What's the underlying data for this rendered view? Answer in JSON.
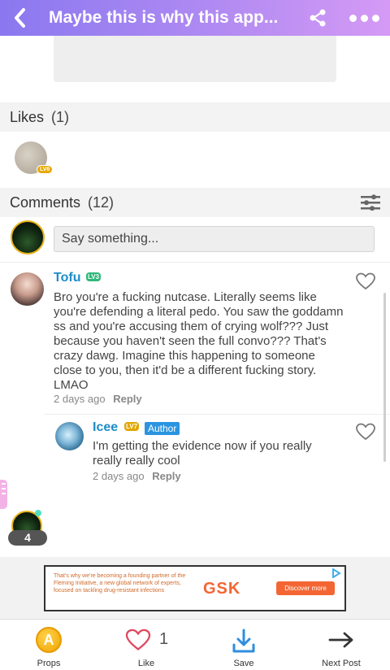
{
  "header": {
    "title": "Maybe this is why this app...",
    "back_icon": "chevron-left-icon",
    "share_icon": "share-icon",
    "more_icon": "more-dots-icon",
    "gradient": [
      "#8a78f0",
      "#d59af5"
    ]
  },
  "likes": {
    "label": "Likes",
    "count": "(1)",
    "users": [
      {
        "level": "LV6"
      }
    ]
  },
  "comments": {
    "label": "Comments",
    "count": "(12)",
    "input_placeholder": "Say something...",
    "items": [
      {
        "author": "Tofu",
        "level": "LV3",
        "text": "Bro you're a fucking nutcase. Literally seems like you're defending a literal pedo. You saw the goddamn ss and you're accusing them of crying wolf??? Just because you haven't seen the full convo??? That's crazy dawg. Imagine this happening to someone close to you, then it'd be a different fucking story. LMAO",
        "time": "2 days ago",
        "reply_label": "Reply"
      },
      {
        "author": "Icee",
        "level": "LV7",
        "tag": "Author",
        "text": "I'm getting the evidence now if you really really really cool",
        "time": "2 days ago",
        "reply_label": "Reply"
      }
    ]
  },
  "online": {
    "count": "4"
  },
  "ad": {
    "text": "That's why we're becoming a founding partner of the Fleming Initiative, a new global network of experts, focused on tackling drug-resistant infections",
    "brand": "GSK",
    "button": "Discover more"
  },
  "bottom_nav": {
    "props": "Props",
    "like": "Like",
    "like_count": "1",
    "save": "Save",
    "next": "Next Post"
  },
  "colors": {
    "accent": "#1e8dc8",
    "heart": "#e0465e",
    "save": "#2e8ee0"
  }
}
